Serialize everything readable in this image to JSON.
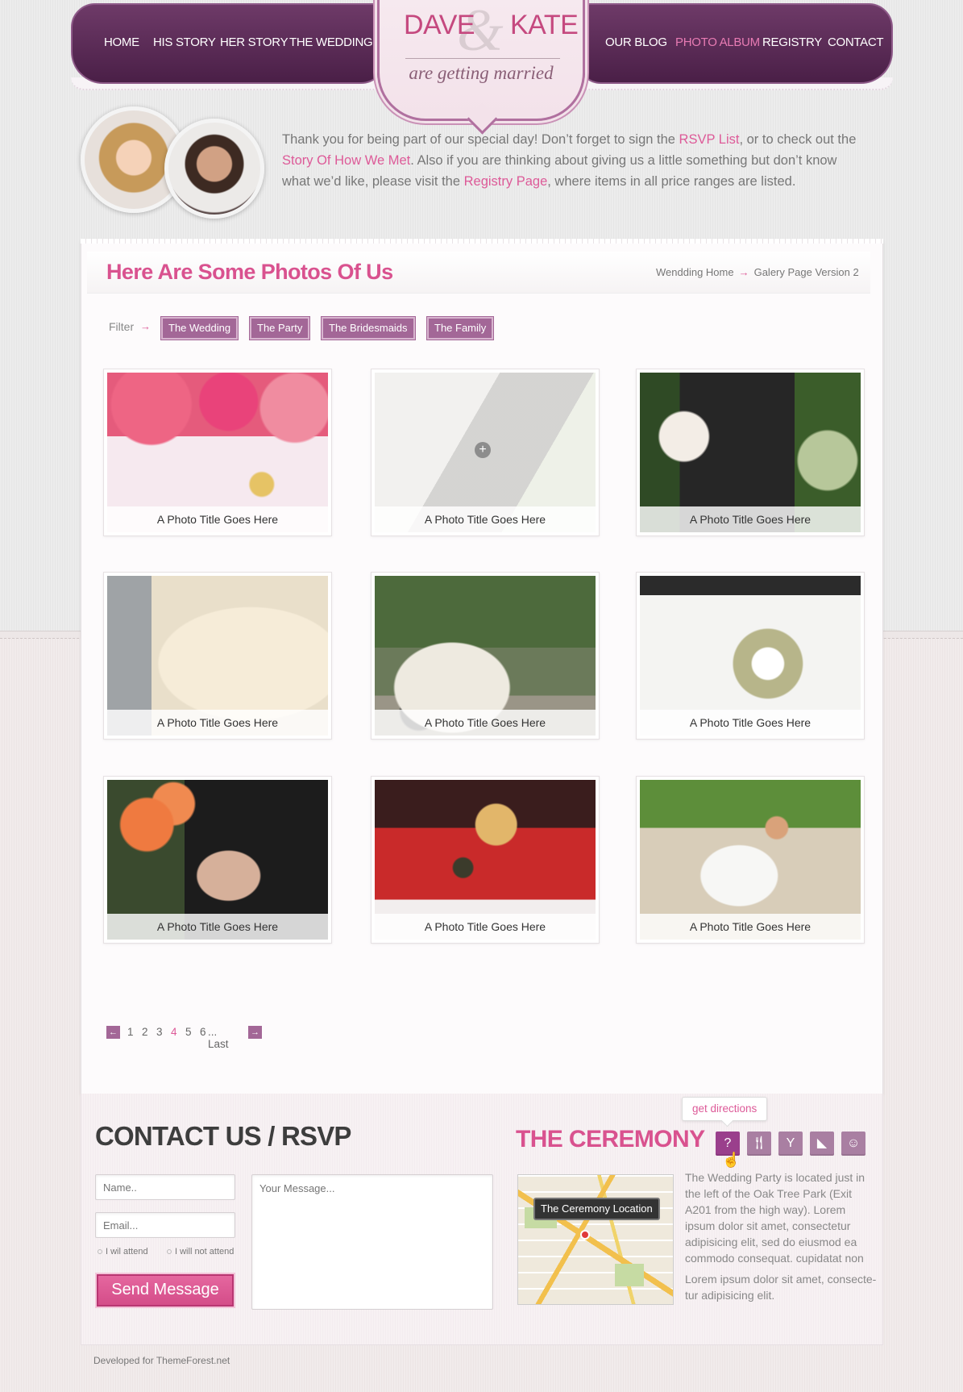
{
  "header": {
    "nav_left": [
      "HOME",
      "HIS STORY",
      "HER STORY",
      "THE WEDDING"
    ],
    "nav_right": [
      "OUR BLOG",
      "PHOTO ALBUM",
      "REGISTRY",
      "CONTACT"
    ],
    "active_item": "PHOTO ALBUM",
    "logo": {
      "name1": "DAVE",
      "amp": "&",
      "name2": "KATE",
      "tagline": "are getting married"
    }
  },
  "intro": {
    "t1": "Thank you for being part of our special day! Don’t forget to sign the ",
    "link1": "RSVP List",
    "t2": ", or to check out the ",
    "link2": "Story Of How We Met",
    "t3": ". Also if you are thinking about giving us a little something but don’t know what we’d like, please visit the ",
    "link3": "Registry Page",
    "t4": ", where items in all price ranges are listed."
  },
  "main": {
    "title": "Here Are Some Photos Of Us",
    "breadcrumb": {
      "home": "Wendding Home",
      "arrow": "→",
      "current": "Galery Page Version 2"
    },
    "filter": {
      "label": "Filter",
      "arrow": "→",
      "options": [
        "The Wedding",
        "The Party",
        "The Bridesmaids",
        "The Family"
      ]
    },
    "photos": [
      {
        "caption": "A Photo Title Goes Here"
      },
      {
        "caption": "A Photo Title Goes Here",
        "plus": "+"
      },
      {
        "caption": "A Photo Title Goes Here"
      },
      {
        "caption": "A Photo Title Goes Here"
      },
      {
        "caption": "A Photo Title Goes Here"
      },
      {
        "caption": "A Photo Title Goes Here"
      },
      {
        "caption": "A Photo Title Goes Here"
      },
      {
        "caption": "A Photo Title Goes Here"
      },
      {
        "caption": "A Photo Title Goes Here"
      }
    ],
    "pagination": {
      "prev": "←",
      "pages": [
        "1",
        "2",
        "3",
        "4",
        "5",
        "6"
      ],
      "current": "4",
      "ellipsis_last": "... Last",
      "next": "→"
    }
  },
  "contact": {
    "title": "CONTACT US / RSVP",
    "name_placeholder": "Name..",
    "email_placeholder": "Email...",
    "message_placeholder": "Your Message...",
    "attend": "I wil attend",
    "not_attend": "I will not attend",
    "send": "Send Message"
  },
  "ceremony": {
    "title": "THE CEREMONY",
    "tooltip": "get directions",
    "icons": [
      "question-icon",
      "cutlery-icon",
      "cocktail-icon",
      "cake-icon",
      "baby-icon"
    ],
    "map_label": "The Ceremony Location",
    "p1": "The Wedding Party is located just in the left of the Oak Tree Park (Exit A201 from the high way). Lorem ipsum dolor sit amet, consectetur adipisicing elit, sed do eiusmod ea commodo consequat. cupidatat non",
    "p2": "Lorem ipsum dolor sit amet, consecte-tur adipisicing elit."
  },
  "footer": {
    "credit": "Developed for ThemeForest.net"
  },
  "colors": {
    "purple": "#5a2c56",
    "pink": "#dd5a98",
    "filter": "#a36797"
  }
}
